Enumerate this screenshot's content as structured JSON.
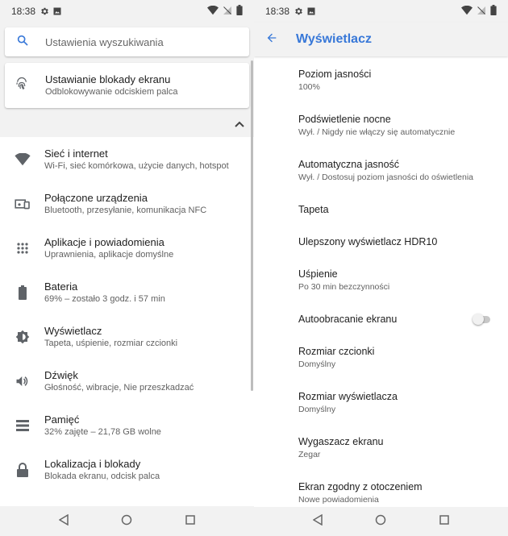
{
  "left": {
    "status": {
      "time": "18:38"
    },
    "search": {
      "placeholder": "Ustawienia wyszukiwania"
    },
    "suggestion": {
      "title": "Ustawianie blokady ekranu",
      "subtitle": "Odblokowywanie odciskiem palca"
    },
    "items": [
      {
        "title": "Sieć i internet",
        "subtitle": "Wi-Fi, sieć komórkowa, użycie danych, hotspot",
        "icon": "wifi-icon"
      },
      {
        "title": "Połączone urządzenia",
        "subtitle": "Bluetooth, przesyłanie, komunikacja NFC",
        "icon": "devices-icon"
      },
      {
        "title": "Aplikacje i powiadomienia",
        "subtitle": "Uprawnienia, aplikacje domyślne",
        "icon": "apps-icon"
      },
      {
        "title": "Bateria",
        "subtitle": "69% – zostało 3 godz. i 57 min",
        "icon": "battery-icon"
      },
      {
        "title": "Wyświetlacz",
        "subtitle": "Tapeta, uśpienie, rozmiar czcionki",
        "icon": "brightness-icon"
      },
      {
        "title": "Dźwięk",
        "subtitle": "Głośność, wibracje, Nie przeszkadzać",
        "icon": "volume-icon"
      },
      {
        "title": "Pamięć",
        "subtitle": "32% zajęte – 21,78 GB wolne",
        "icon": "storage-icon"
      },
      {
        "title": "Lokalizacja i blokady",
        "subtitle": "Blokada ekranu, odcisk palca",
        "icon": "lock-icon"
      }
    ]
  },
  "right": {
    "status": {
      "time": "18:38"
    },
    "title": "Wyświetlacz",
    "settings": [
      {
        "title": "Poziom jasności",
        "subtitle": "100%"
      },
      {
        "title": "Podświetlenie nocne",
        "subtitle": "Wył. / Nigdy nie włączy się automatycznie"
      },
      {
        "title": "Automatyczna jasność",
        "subtitle": "Wył. / Dostosuj poziom jasności do oświetlenia"
      },
      {
        "title": "Tapeta",
        "subtitle": ""
      },
      {
        "title": "Ulepszony wyświetlacz HDR10",
        "subtitle": ""
      },
      {
        "title": "Uśpienie",
        "subtitle": "Po 30 min bezczynności"
      },
      {
        "title": "Autoobracanie ekranu",
        "subtitle": "",
        "toggle": false
      },
      {
        "title": "Rozmiar czcionki",
        "subtitle": "Domyślny"
      },
      {
        "title": "Rozmiar wyświetlacza",
        "subtitle": "Domyślny"
      },
      {
        "title": "Wygaszacz ekranu",
        "subtitle": "Zegar"
      },
      {
        "title": "Ekran zgodny z otoczeniem",
        "subtitle": "Nowe powiadomienia"
      }
    ]
  },
  "colors": {
    "accent": "#3878d8",
    "icon": "#5f6368",
    "background": "#f2f2f2"
  }
}
